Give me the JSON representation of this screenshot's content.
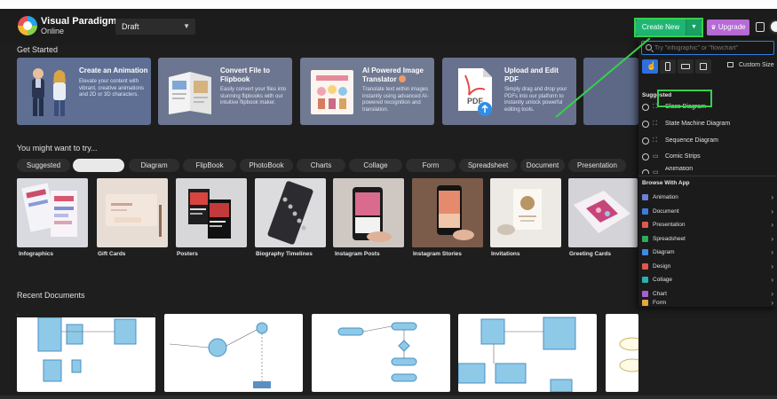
{
  "header": {
    "brand_line1": "Visual Paradigm",
    "brand_line2": "Online",
    "draft_label": "Draft",
    "create_new_label": "Create New",
    "upgrade_label": "Upgrade"
  },
  "sections": {
    "get_started": "Get Started",
    "you_might": "You might want to try...",
    "recent": "Recent Documents"
  },
  "feature_cards": [
    {
      "title": "Create an Animation",
      "desc": "Elevate your content with vibrant, creative animations and 2D or 3D characters.",
      "bg": "#5f6f94"
    },
    {
      "title": "Convert File to Flipbook",
      "desc": "Easily convert your files into stunning flipbooks with our intuitive flipbook maker.",
      "bg": "#6d7690"
    },
    {
      "title": "AI Powered Image Translator",
      "desc": "Translate text within images instantly using advanced AI-powered recognition and translation.",
      "bg": "#707a93"
    },
    {
      "title": "Upload and Edit PDF",
      "desc": "Simply drag and drop your PDFs into our platform to instantly unlock powerful editing tools.",
      "bg": "#68728f"
    }
  ],
  "tabs": [
    "Suggested",
    "Visual",
    "Diagram",
    "FlipBook",
    "PhotoBook",
    "Charts",
    "Collage",
    "Form",
    "Spreadsheet",
    "Document",
    "Presentation"
  ],
  "templates": [
    "Infographics",
    "Gift Cards",
    "Posters",
    "Biography Timelines",
    "Instagram Posts",
    "Instagram Stories",
    "Invitations",
    "Greeting Cards"
  ],
  "dropdown": {
    "search_placeholder": "Try \"infographic\" or \"flowchart\"",
    "custom_size_label": "Custom Size",
    "suggested_heading": "Suggested",
    "suggested": [
      "Class Diagram",
      "State Machine Diagram",
      "Sequence Diagram",
      "Comic Strips",
      "Animation"
    ],
    "browse_heading": "Browse With App",
    "browse": [
      {
        "label": "Animation",
        "color": "#6f7ed8"
      },
      {
        "label": "Document",
        "color": "#3d7be0"
      },
      {
        "label": "Presentation",
        "color": "#e0584f"
      },
      {
        "label": "Spreadsheet",
        "color": "#2eab5d"
      },
      {
        "label": "Diagram",
        "color": "#3f8ae8"
      },
      {
        "label": "Design",
        "color": "#e0574f"
      },
      {
        "label": "Collage",
        "color": "#27b2b2"
      },
      {
        "label": "Chart",
        "color": "#a65fd0"
      },
      {
        "label": "Form",
        "color": "#e1a83a"
      }
    ]
  },
  "colors": {
    "accent_green": "#1fb673",
    "upgrade_purple": "#b86ad6",
    "highlight": "#35d14a",
    "select_blue": "#2f6fdc"
  }
}
